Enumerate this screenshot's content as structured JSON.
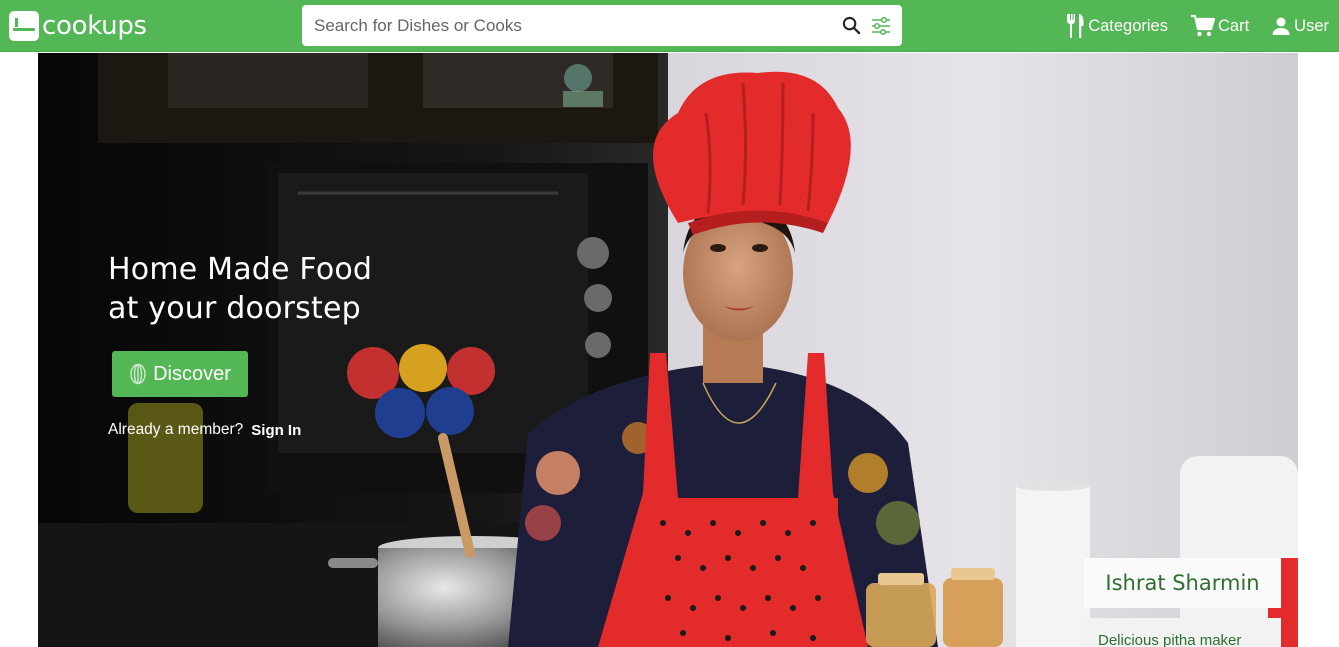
{
  "navbar": {
    "brand_name": "cookups",
    "search": {
      "placeholder": "Search for Dishes or Cooks",
      "value": ""
    },
    "categories_label": "Categories",
    "cart_label": "Cart",
    "user_label": "User"
  },
  "hero": {
    "title_line1": "Home Made Food",
    "title_line2": "at your doorstep",
    "discover_label": "Discover",
    "member_prompt": "Already a member?",
    "signin_label": "Sign In",
    "cook_name": "Ishrat Sharmin",
    "cook_description": "Delicious pitha maker"
  },
  "colors": {
    "brand_green": "#53b756",
    "cook_text_green": "#2e6e32",
    "apron_red": "#e32b2b"
  },
  "icons": [
    "brand-logo-icon",
    "search-icon",
    "filter-icon",
    "fork-knife-icon",
    "cart-icon",
    "user-icon",
    "whisk-icon"
  ]
}
